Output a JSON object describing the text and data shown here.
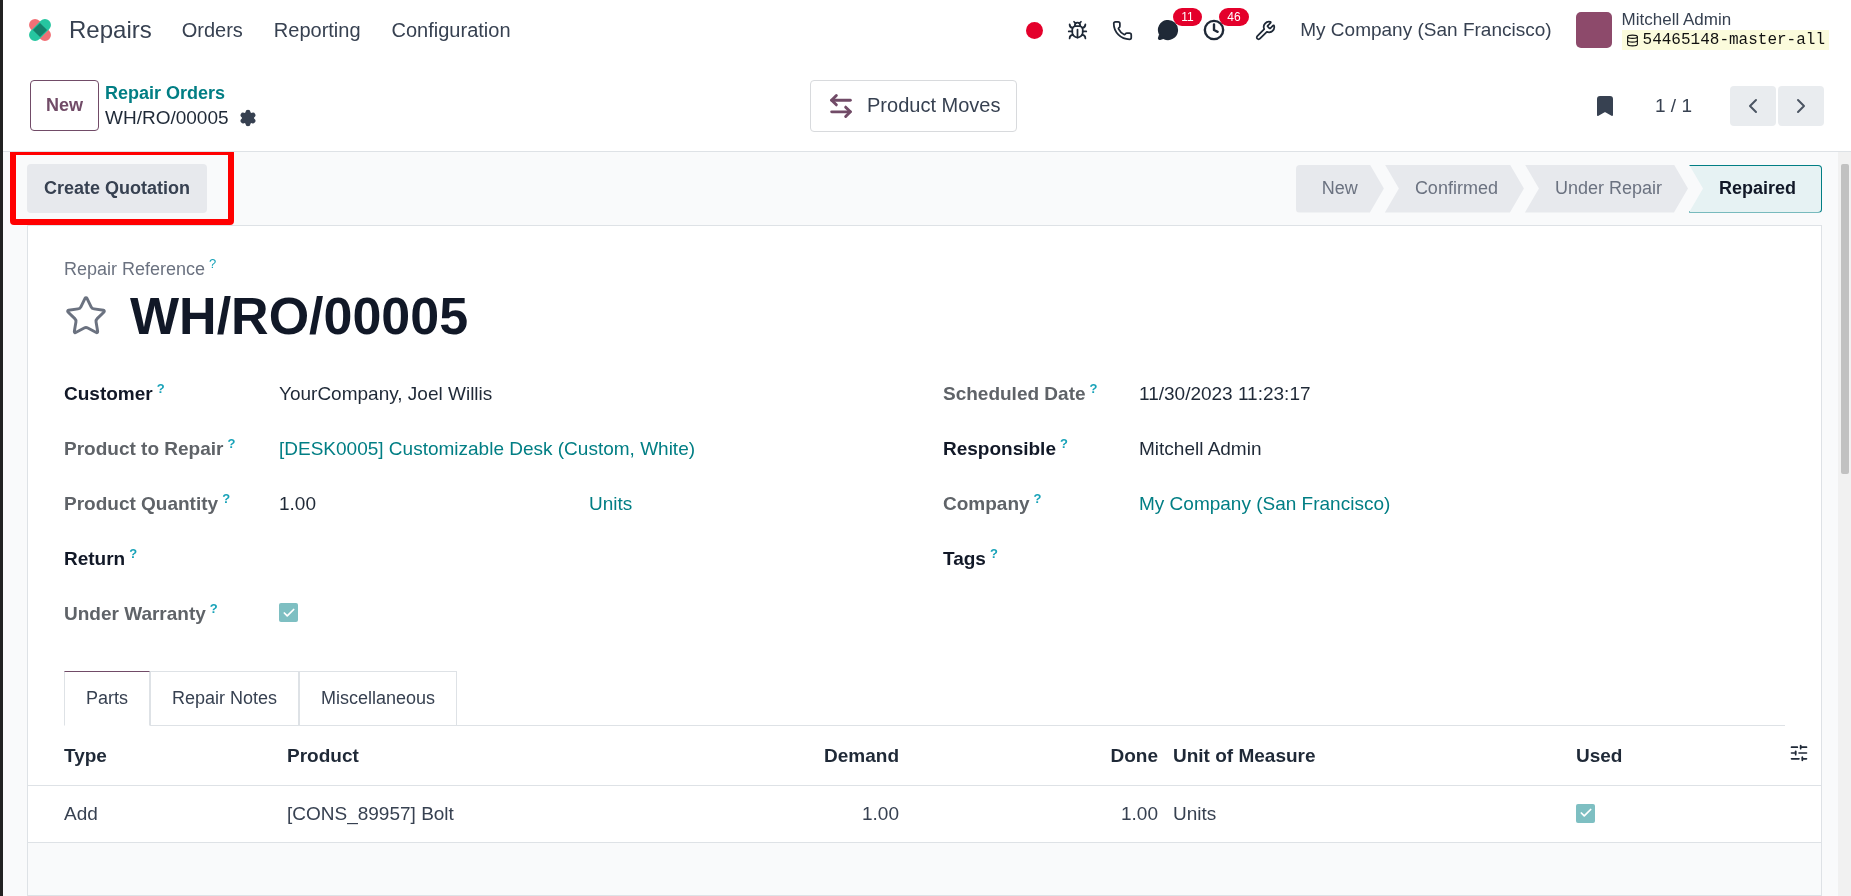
{
  "navbar": {
    "app_name": "Repairs",
    "menu": [
      "Orders",
      "Reporting",
      "Configuration"
    ],
    "messages_count": "11",
    "activities_count": "46",
    "company": "My Company (San Francisco)",
    "user_name": "Mitchell Admin",
    "database": "54465148-master-all"
  },
  "control_panel": {
    "new_button": "New",
    "breadcrumb": "Repair Orders",
    "record": "WH/RO/00005",
    "smart_button": "Product Moves",
    "pager": "1 / 1"
  },
  "action_bar": {
    "button": "Create Quotation",
    "highlighted": true,
    "stages": [
      {
        "label": "New",
        "selected": false
      },
      {
        "label": "Confirmed",
        "selected": false
      },
      {
        "label": "Under Repair",
        "selected": false
      },
      {
        "label": "Repaired",
        "selected": true
      }
    ]
  },
  "form": {
    "reference_label": "Repair Reference",
    "help_mark": "?",
    "title": "WH/RO/00005",
    "starred": false,
    "left_fields": [
      {
        "label": "Customer",
        "required": true,
        "kind": "text",
        "value": "YourCompany, Joel Willis"
      },
      {
        "label": "Product to Repair",
        "required": false,
        "kind": "link",
        "value": "[DESK0005] Customizable Desk (Custom, White)"
      },
      {
        "label": "Product Quantity",
        "required": false,
        "kind": "quantity",
        "value": "1.00",
        "unit": "Units"
      },
      {
        "label": "Return",
        "required": true,
        "kind": "empty"
      },
      {
        "label": "Under Warranty",
        "required": false,
        "kind": "checkbox",
        "checked": true
      }
    ],
    "right_fields": [
      {
        "label": "Scheduled Date",
        "required": false,
        "kind": "text",
        "value": "11/30/2023 11:23:17"
      },
      {
        "label": "Responsible",
        "required": true,
        "kind": "text",
        "value": "Mitchell Admin"
      },
      {
        "label": "Company",
        "required": false,
        "kind": "link",
        "value": "My Company (San Francisco)"
      },
      {
        "label": "Tags",
        "required": true,
        "kind": "empty"
      }
    ]
  },
  "tabs": [
    {
      "label": "Parts",
      "selected": true
    },
    {
      "label": "Repair Notes",
      "selected": false
    },
    {
      "label": "Miscellaneous",
      "selected": false
    }
  ],
  "table": {
    "columns": [
      {
        "label": "Type",
        "numeric": false
      },
      {
        "label": "Product",
        "numeric": false
      },
      {
        "label": "Demand",
        "numeric": true
      },
      {
        "label": "Done",
        "numeric": true
      },
      {
        "label": "Unit of Measure",
        "numeric": false
      },
      {
        "label": "Used",
        "numeric": false
      }
    ],
    "rows": [
      {
        "type": "Add",
        "product": "[CONS_89957] Bolt",
        "demand": "1.00",
        "done": "1.00",
        "unit": "Units",
        "used": true
      }
    ]
  }
}
